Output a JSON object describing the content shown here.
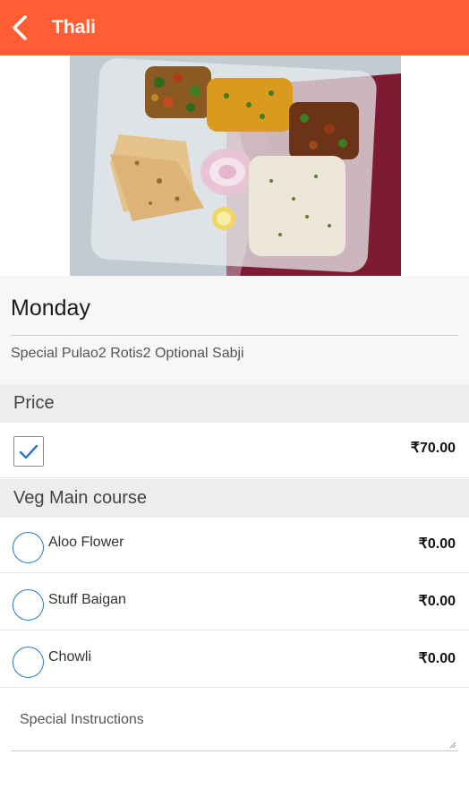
{
  "header": {
    "title": "Thali",
    "back_icon": "chevron-left-icon"
  },
  "hero": {
    "image": "thali-meal-tray-photo"
  },
  "info": {
    "day": "Monday",
    "description": "Special Pulao2 Rotis2 Optional Sabji"
  },
  "price_section": {
    "title": "Price",
    "checked": true,
    "price": "₹70.00"
  },
  "veg_section": {
    "title": "Veg Main course",
    "items": [
      {
        "label": "Aloo Flower",
        "price": "₹0.00"
      },
      {
        "label": "Stuff Baigan",
        "price": "₹0.00"
      },
      {
        "label": "Chowli",
        "price": "₹0.00"
      }
    ]
  },
  "instructions": {
    "placeholder": "Special Instructions",
    "value": ""
  },
  "colors": {
    "accent": "#FF5E34",
    "radio": "#2c74c9",
    "check": "#2c74c9"
  }
}
